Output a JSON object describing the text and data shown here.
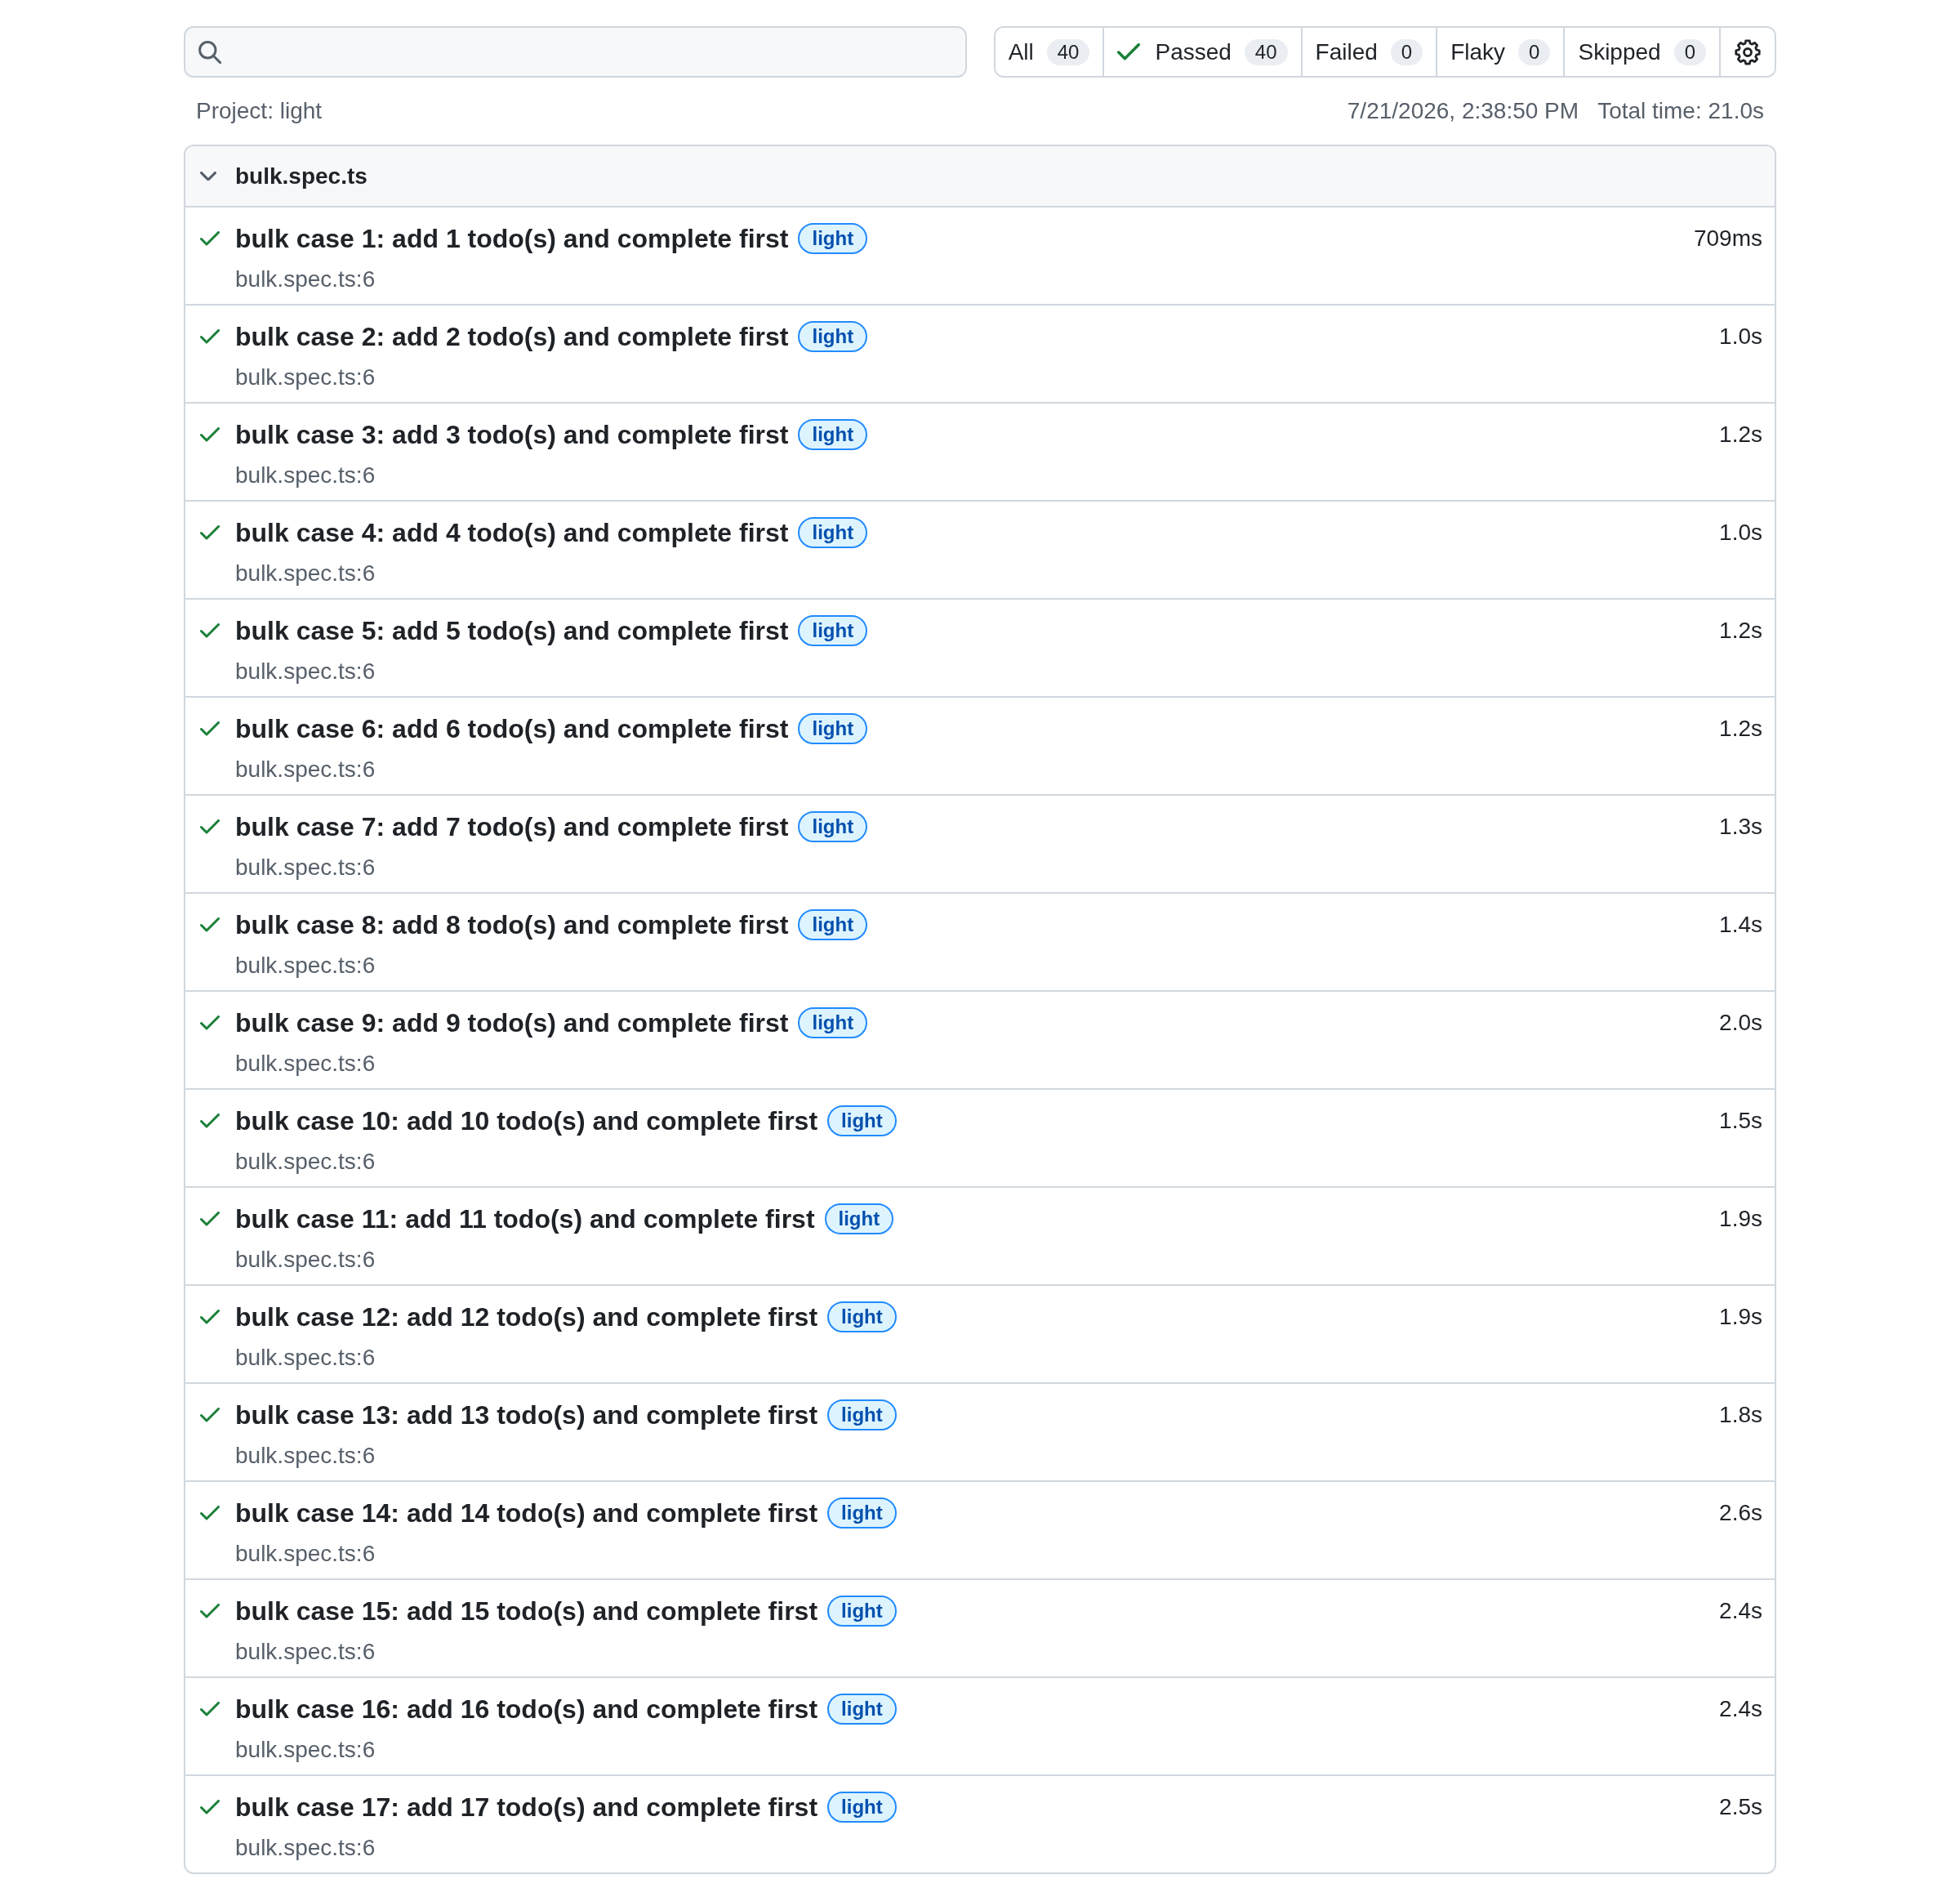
{
  "filters": [
    {
      "kind": "all",
      "label": "All",
      "count": "40"
    },
    {
      "kind": "passed",
      "label": "Passed",
      "count": "40"
    },
    {
      "kind": "failed",
      "label": "Failed",
      "count": "0"
    },
    {
      "kind": "flaky",
      "label": "Flaky",
      "count": "0"
    },
    {
      "kind": "skipped",
      "label": "Skipped",
      "count": "0"
    }
  ],
  "meta": {
    "project": "Project: light",
    "date": "7/21/2026, 2:38:50 PM",
    "total_time": "Total time: 21.0s"
  },
  "file": {
    "name": "bulk.spec.ts",
    "expanded": true,
    "tests": [
      {
        "kind": "passed",
        "title": "bulk case 1: add 1 todo(s) and complete first",
        "tags": [
          "light"
        ],
        "location": "bulk.spec.ts:6",
        "duration": "709ms"
      },
      {
        "kind": "passed",
        "title": "bulk case 2: add 2 todo(s) and complete first",
        "tags": [
          "light"
        ],
        "location": "bulk.spec.ts:6",
        "duration": "1.0s"
      },
      {
        "kind": "passed",
        "title": "bulk case 3: add 3 todo(s) and complete first",
        "tags": [
          "light"
        ],
        "location": "bulk.spec.ts:6",
        "duration": "1.2s"
      },
      {
        "kind": "passed",
        "title": "bulk case 4: add 4 todo(s) and complete first",
        "tags": [
          "light"
        ],
        "location": "bulk.spec.ts:6",
        "duration": "1.0s"
      },
      {
        "kind": "passed",
        "title": "bulk case 5: add 5 todo(s) and complete first",
        "tags": [
          "light"
        ],
        "location": "bulk.spec.ts:6",
        "duration": "1.2s"
      },
      {
        "kind": "passed",
        "title": "bulk case 6: add 6 todo(s) and complete first",
        "tags": [
          "light"
        ],
        "location": "bulk.spec.ts:6",
        "duration": "1.2s"
      },
      {
        "kind": "passed",
        "title": "bulk case 7: add 7 todo(s) and complete first",
        "tags": [
          "light"
        ],
        "location": "bulk.spec.ts:6",
        "duration": "1.3s"
      },
      {
        "kind": "passed",
        "title": "bulk case 8: add 8 todo(s) and complete first",
        "tags": [
          "light"
        ],
        "location": "bulk.spec.ts:6",
        "duration": "1.4s"
      },
      {
        "kind": "passed",
        "title": "bulk case 9: add 9 todo(s) and complete first",
        "tags": [
          "light"
        ],
        "location": "bulk.spec.ts:6",
        "duration": "2.0s"
      },
      {
        "kind": "passed",
        "title": "bulk case 10: add 10 todo(s) and complete first",
        "tags": [
          "light"
        ],
        "location": "bulk.spec.ts:6",
        "duration": "1.5s"
      },
      {
        "kind": "passed",
        "title": "bulk case 11: add 11 todo(s) and complete first",
        "tags": [
          "light"
        ],
        "location": "bulk.spec.ts:6",
        "duration": "1.9s"
      },
      {
        "kind": "passed",
        "title": "bulk case 12: add 12 todo(s) and complete first",
        "tags": [
          "light"
        ],
        "location": "bulk.spec.ts:6",
        "duration": "1.9s"
      },
      {
        "kind": "passed",
        "title": "bulk case 13: add 13 todo(s) and complete first",
        "tags": [
          "light"
        ],
        "location": "bulk.spec.ts:6",
        "duration": "1.8s"
      },
      {
        "kind": "passed",
        "title": "bulk case 14: add 14 todo(s) and complete first",
        "tags": [
          "light"
        ],
        "location": "bulk.spec.ts:6",
        "duration": "2.6s"
      },
      {
        "kind": "passed",
        "title": "bulk case 15: add 15 todo(s) and complete first",
        "tags": [
          "light"
        ],
        "location": "bulk.spec.ts:6",
        "duration": "2.4s"
      },
      {
        "kind": "passed",
        "title": "bulk case 16: add 16 todo(s) and complete first",
        "tags": [
          "light"
        ],
        "location": "bulk.spec.ts:6",
        "duration": "2.4s"
      },
      {
        "kind": "passed",
        "title": "bulk case 17: add 17 todo(s) and complete first",
        "tags": [
          "light"
        ],
        "location": "bulk.spec.ts:6",
        "duration": "2.5s"
      }
    ]
  }
}
